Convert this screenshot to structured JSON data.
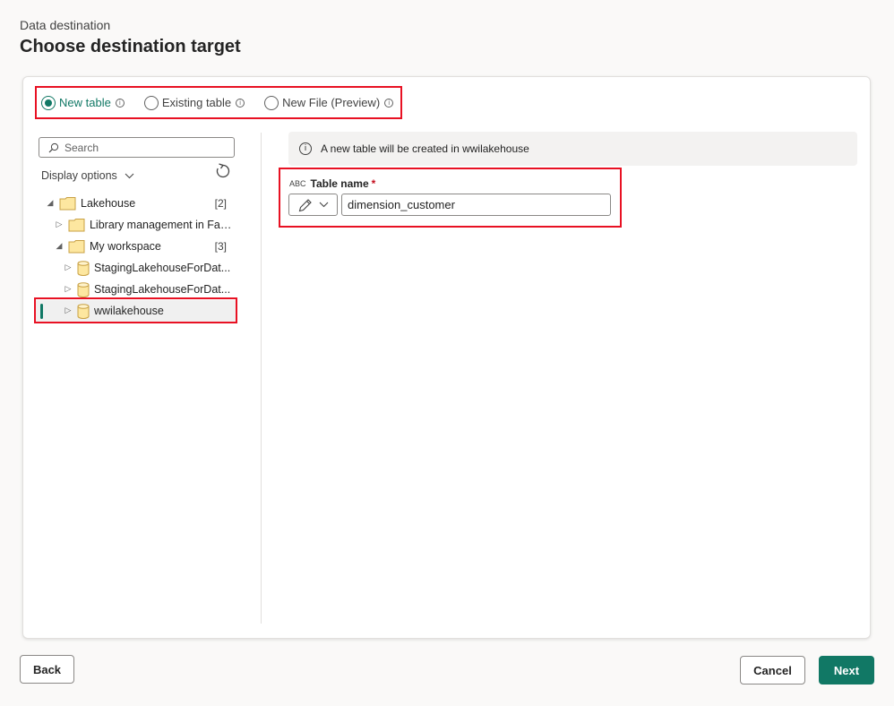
{
  "header": {
    "eyebrow": "Data destination",
    "title": "Choose destination target"
  },
  "options": [
    {
      "label": "New table",
      "checked": true
    },
    {
      "label": "Existing table",
      "checked": false
    },
    {
      "label": "New File (Preview)",
      "checked": false
    }
  ],
  "search": {
    "placeholder": "Search"
  },
  "display_options": "Display options",
  "tree": [
    {
      "label": "Lakehouse",
      "count": "[2]",
      "icon": "folder-icon",
      "expanded": true
    },
    {
      "label": "Library management in Fab...",
      "count": "",
      "icon": "folder-icon",
      "expanded": false
    },
    {
      "label": "My workspace",
      "count": "[3]",
      "icon": "folder-icon",
      "expanded": true
    },
    {
      "label": "StagingLakehouseForDat...",
      "count": "",
      "icon": "lakehouse-icon",
      "expanded": false
    },
    {
      "label": "StagingLakehouseForDat...",
      "count": "",
      "icon": "lakehouse-icon",
      "expanded": false
    },
    {
      "label": "wwilakehouse",
      "count": "",
      "icon": "lakehouse-icon",
      "expanded": false,
      "selected": true
    }
  ],
  "info_message": "A new table will be created in wwilakehouse",
  "table_name": {
    "label": "Table name",
    "required_mark": "*",
    "value": "dimension_customer",
    "type_glyph": "ABC"
  },
  "footer": {
    "back": "Back",
    "cancel": "Cancel",
    "next": "Next"
  },
  "colors": {
    "accent": "#117865",
    "highlight": "#e81123"
  }
}
